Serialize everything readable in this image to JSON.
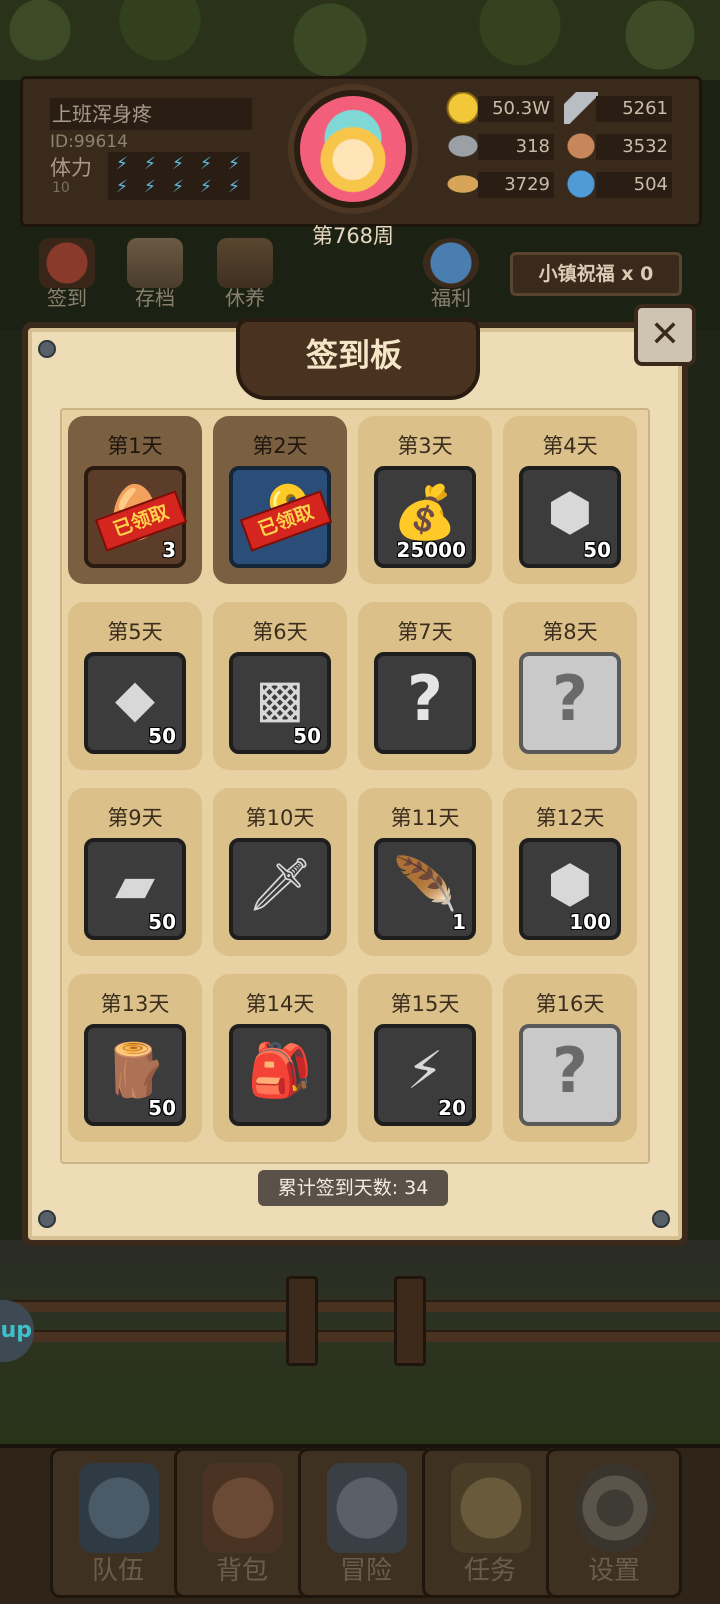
{
  "player": {
    "name": "上班浑身疼",
    "id": "ID:99614",
    "stamina_label": "体力",
    "stamina_value": "10"
  },
  "week_label": "第768周",
  "resources": [
    {
      "icon": "gold-coin-icon",
      "value": "50.3W"
    },
    {
      "icon": "iron-bar-icon",
      "value": "5261"
    },
    {
      "icon": "ore-icon",
      "value": "318"
    },
    {
      "icon": "leather-icon",
      "value": "3532"
    },
    {
      "icon": "wood-log-icon",
      "value": "3729"
    },
    {
      "icon": "crystal-icon",
      "value": "504"
    }
  ],
  "quick_buttons": [
    {
      "label": "签到",
      "icon": "signin-icon"
    },
    {
      "label": "存档",
      "icon": "save-scroll-icon"
    },
    {
      "label": "休养",
      "icon": "rest-chest-icon"
    },
    {
      "label": "福利",
      "icon": "welfare-wheel-icon"
    }
  ],
  "blessing_label": "小镇祝福 x 0",
  "board": {
    "title": "签到板",
    "close_icon": "close-icon",
    "total_label": "累计签到天数: 34"
  },
  "days": [
    {
      "label": "第1天",
      "icon": "egg-item-icon",
      "count": "3",
      "claimed": true,
      "claimed_label": "已领取"
    },
    {
      "label": "第2天",
      "icon": "key-item-icon",
      "count": "",
      "claimed": true,
      "claimed_label": "已领取"
    },
    {
      "label": "第3天",
      "icon": "money-bag-icon",
      "count": "25000",
      "claimed": false
    },
    {
      "label": "第4天",
      "icon": "silver-ore-icon",
      "count": "50",
      "claimed": false
    },
    {
      "label": "第5天",
      "icon": "stone-icon",
      "count": "50",
      "claimed": false
    },
    {
      "label": "第6天",
      "icon": "leather-icon",
      "count": "50",
      "claimed": false
    },
    {
      "label": "第7天",
      "icon": "question-icon",
      "count": "",
      "claimed": false
    },
    {
      "label": "第8天",
      "icon": "question-icon",
      "count": "",
      "claimed": false
    },
    {
      "label": "第9天",
      "icon": "iron-bar-icon",
      "count": "50",
      "claimed": false
    },
    {
      "label": "第10天",
      "icon": "sword-icon",
      "count": "",
      "claimed": false
    },
    {
      "label": "第11天",
      "icon": "feather-icon",
      "count": "1",
      "claimed": false
    },
    {
      "label": "第12天",
      "icon": "silver-ore-icon",
      "count": "100",
      "claimed": false
    },
    {
      "label": "第13天",
      "icon": "wood-log-icon",
      "count": "50",
      "claimed": false
    },
    {
      "label": "第14天",
      "icon": "backpack-icon",
      "count": "",
      "claimed": false
    },
    {
      "label": "第15天",
      "icon": "rune-stone-icon",
      "count": "20",
      "claimed": false
    },
    {
      "label": "第16天",
      "icon": "question-icon",
      "count": "",
      "claimed": false
    }
  ],
  "side_tab": "up",
  "nav": [
    {
      "label": "队伍",
      "icon": "team-helmet-icon"
    },
    {
      "label": "背包",
      "icon": "backpack-icon"
    },
    {
      "label": "冒险",
      "icon": "crossed-swords-icon"
    },
    {
      "label": "任务",
      "icon": "quest-scroll-icon"
    },
    {
      "label": "设置",
      "icon": "gear-icon"
    }
  ]
}
